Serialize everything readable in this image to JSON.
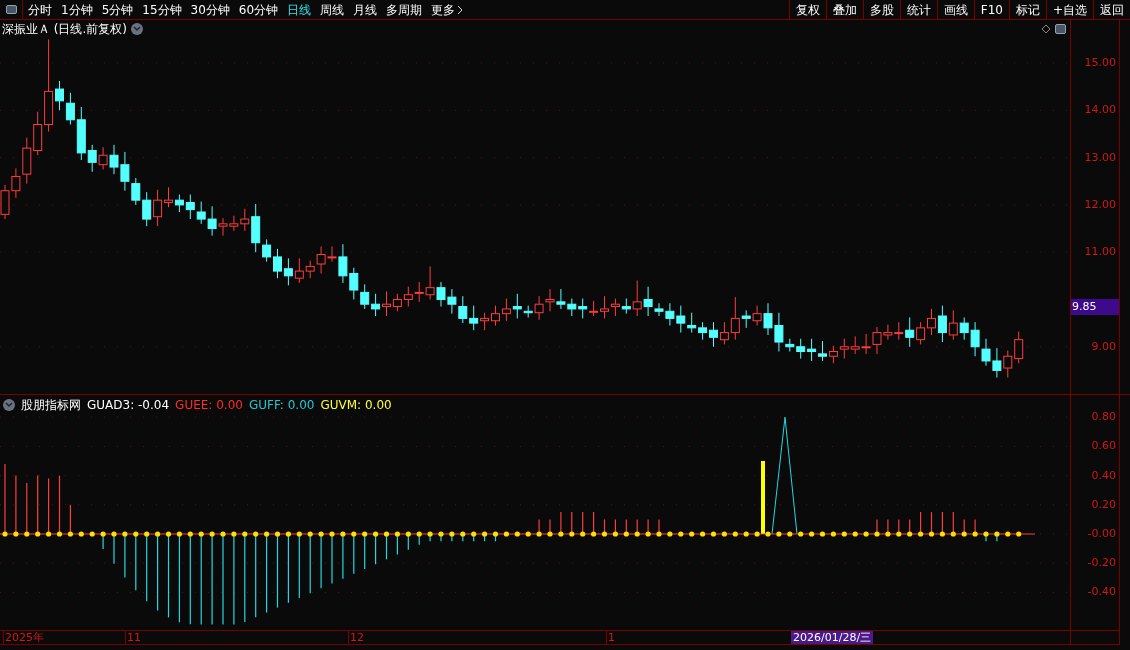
{
  "toolbar": {
    "periods": [
      {
        "label": "分时",
        "selected": false
      },
      {
        "label": "1分钟",
        "selected": false
      },
      {
        "label": "5分钟",
        "selected": false
      },
      {
        "label": "15分钟",
        "selected": false
      },
      {
        "label": "30分钟",
        "selected": false
      },
      {
        "label": "60分钟",
        "selected": false
      },
      {
        "label": "日线",
        "selected": true
      },
      {
        "label": "周线",
        "selected": false
      },
      {
        "label": "月线",
        "selected": false
      },
      {
        "label": "多周期",
        "selected": false
      },
      {
        "label": "更多",
        "selected": false
      }
    ],
    "actions": [
      "复权",
      "叠加",
      "多股",
      "统计",
      "画线",
      "F10",
      "标记",
      "+自选",
      "返回"
    ]
  },
  "chart": {
    "title": "深振业Ａ (日线.前复权)",
    "current_price": "9.85",
    "chart_data": {
      "type": "candlestick",
      "grid": true,
      "ylim": [
        7.98,
        15.91
      ],
      "yticks": [
        {
          "value": 15,
          "label": "15.00"
        },
        {
          "value": 14,
          "label": "14.00"
        },
        {
          "value": 13,
          "label": "13.00"
        },
        {
          "value": 12,
          "label": "12.00"
        },
        {
          "value": 11,
          "label": "11.00"
        },
        {
          "value": 9,
          "label": "9.00"
        }
      ],
      "ohlc": [
        [
          11.8,
          12.42,
          11.7,
          12.3
        ],
        [
          12.3,
          12.77,
          12.15,
          12.6
        ],
        [
          12.65,
          13.42,
          12.45,
          13.2
        ],
        [
          13.15,
          13.97,
          13.05,
          13.7
        ],
        [
          13.7,
          15.5,
          13.55,
          14.4
        ],
        [
          14.45,
          14.62,
          14.0,
          14.2
        ],
        [
          14.15,
          14.37,
          13.7,
          13.8
        ],
        [
          13.8,
          14.07,
          12.95,
          13.1
        ],
        [
          13.15,
          13.27,
          12.7,
          12.9
        ],
        [
          12.85,
          13.22,
          12.75,
          13.05
        ],
        [
          13.05,
          13.27,
          12.65,
          12.8
        ],
        [
          12.85,
          13.12,
          12.3,
          12.5
        ],
        [
          12.45,
          12.57,
          12.0,
          12.1
        ],
        [
          12.1,
          12.27,
          11.55,
          11.7
        ],
        [
          11.75,
          12.32,
          11.55,
          12.1
        ],
        [
          12.05,
          12.37,
          11.95,
          12.1
        ],
        [
          12.1,
          12.22,
          11.85,
          12.0
        ],
        [
          12.05,
          12.22,
          11.7,
          11.9
        ],
        [
          11.85,
          12.07,
          11.6,
          11.7
        ],
        [
          11.7,
          11.97,
          11.35,
          11.5
        ],
        [
          11.55,
          11.72,
          11.35,
          11.6
        ],
        [
          11.55,
          11.77,
          11.45,
          11.6
        ],
        [
          11.6,
          11.92,
          11.45,
          11.7
        ],
        [
          11.75,
          12.02,
          11.0,
          11.2
        ],
        [
          11.15,
          11.27,
          10.8,
          10.9
        ],
        [
          10.9,
          11.07,
          10.45,
          10.6
        ],
        [
          10.65,
          10.87,
          10.3,
          10.5
        ],
        [
          10.45,
          10.87,
          10.35,
          10.6
        ],
        [
          10.6,
          10.82,
          10.45,
          10.7
        ],
        [
          10.75,
          11.12,
          10.55,
          10.95
        ],
        [
          10.9,
          11.12,
          10.8,
          10.9
        ],
        [
          10.9,
          11.17,
          10.35,
          10.5
        ],
        [
          10.55,
          10.67,
          10.0,
          10.2
        ],
        [
          10.15,
          10.32,
          9.8,
          9.9
        ],
        [
          9.9,
          10.12,
          9.65,
          9.8
        ],
        [
          9.85,
          10.17,
          9.65,
          9.9
        ],
        [
          9.85,
          10.12,
          9.75,
          10.0
        ],
        [
          10.0,
          10.27,
          9.85,
          10.1
        ],
        [
          10.15,
          10.37,
          9.95,
          10.15
        ],
        [
          10.1,
          10.7,
          10.0,
          10.25
        ],
        [
          10.25,
          10.37,
          9.85,
          10.0
        ],
        [
          10.05,
          10.22,
          9.7,
          9.9
        ],
        [
          9.85,
          10.07,
          9.5,
          9.6
        ],
        [
          9.6,
          9.87,
          9.35,
          9.5
        ],
        [
          9.55,
          9.72,
          9.35,
          9.6
        ],
        [
          9.55,
          9.87,
          9.45,
          9.7
        ],
        [
          9.7,
          10.02,
          9.55,
          9.8
        ],
        [
          9.85,
          10.12,
          9.6,
          9.8
        ],
        [
          9.75,
          9.87,
          9.62,
          9.72
        ],
        [
          9.72,
          10.07,
          9.57,
          9.9
        ],
        [
          9.95,
          10.22,
          9.75,
          10.0
        ],
        [
          9.95,
          10.22,
          9.8,
          9.9
        ],
        [
          9.9,
          10.02,
          9.65,
          9.8
        ],
        [
          9.85,
          10.02,
          9.6,
          9.8
        ],
        [
          9.75,
          9.97,
          9.65,
          9.75
        ],
        [
          9.75,
          10.07,
          9.6,
          9.8
        ],
        [
          9.85,
          10.02,
          9.65,
          9.9
        ],
        [
          9.85,
          10.02,
          9.7,
          9.8
        ],
        [
          9.8,
          10.4,
          9.65,
          9.95
        ],
        [
          10.0,
          10.27,
          9.65,
          9.85
        ],
        [
          9.8,
          9.92,
          9.65,
          9.75
        ],
        [
          9.75,
          9.92,
          9.45,
          9.6
        ],
        [
          9.65,
          9.87,
          9.3,
          9.5
        ],
        [
          9.45,
          9.72,
          9.3,
          9.4
        ],
        [
          9.4,
          9.52,
          9.15,
          9.3
        ],
        [
          9.35,
          9.52,
          9.0,
          9.2
        ],
        [
          9.15,
          9.52,
          9.05,
          9.3
        ],
        [
          9.3,
          10.05,
          9.15,
          9.6
        ],
        [
          9.65,
          9.77,
          9.4,
          9.6
        ],
        [
          9.55,
          9.87,
          9.45,
          9.7
        ],
        [
          9.7,
          9.92,
          9.25,
          9.4
        ],
        [
          9.45,
          9.72,
          8.9,
          9.1
        ],
        [
          9.05,
          9.17,
          8.9,
          9.0
        ],
        [
          9.0,
          9.17,
          8.75,
          8.9
        ],
        [
          8.95,
          9.17,
          8.7,
          8.9
        ],
        [
          8.85,
          9.12,
          8.7,
          8.8
        ],
        [
          8.8,
          9.02,
          8.65,
          8.9
        ],
        [
          8.95,
          9.17,
          8.75,
          9.0
        ],
        [
          8.95,
          9.22,
          8.85,
          9.0
        ],
        [
          9.0,
          9.27,
          8.85,
          9.0
        ],
        [
          9.05,
          9.42,
          8.85,
          9.3
        ],
        [
          9.25,
          9.47,
          9.15,
          9.3
        ],
        [
          9.3,
          9.52,
          9.15,
          9.3
        ],
        [
          9.35,
          9.62,
          9.0,
          9.2
        ],
        [
          9.15,
          9.52,
          9.05,
          9.4
        ],
        [
          9.4,
          9.8,
          9.25,
          9.6
        ],
        [
          9.65,
          9.87,
          9.1,
          9.3
        ],
        [
          9.25,
          9.77,
          9.15,
          9.5
        ],
        [
          9.5,
          9.62,
          9.15,
          9.3
        ],
        [
          9.35,
          9.52,
          8.8,
          9.0
        ],
        [
          8.95,
          9.17,
          8.6,
          8.7
        ],
        [
          8.7,
          8.97,
          8.35,
          8.5
        ],
        [
          8.55,
          8.92,
          8.35,
          8.8
        ],
        [
          8.75,
          9.32,
          8.65,
          9.15
        ]
      ]
    }
  },
  "indicator": {
    "name": "股朋指标网",
    "values": [
      {
        "label": "GUAD3: -0.04",
        "color": "#ffffff"
      },
      {
        "label": "GUEE: 0.00",
        "color": "#ff2a2a"
      },
      {
        "label": "GUFF: 0.00",
        "color": "#22c8d0"
      },
      {
        "label": "GUVM: 0.00",
        "color": "#ffff33"
      }
    ],
    "ticks": [
      "0.80",
      "0.60",
      "0.40",
      "0.20",
      "-0.00",
      "-0.20",
      "-0.40"
    ]
  },
  "date_axis": {
    "labels": [
      "2025年",
      "11",
      "12",
      "1"
    ],
    "cursor_date": "2026/01/28/三"
  }
}
